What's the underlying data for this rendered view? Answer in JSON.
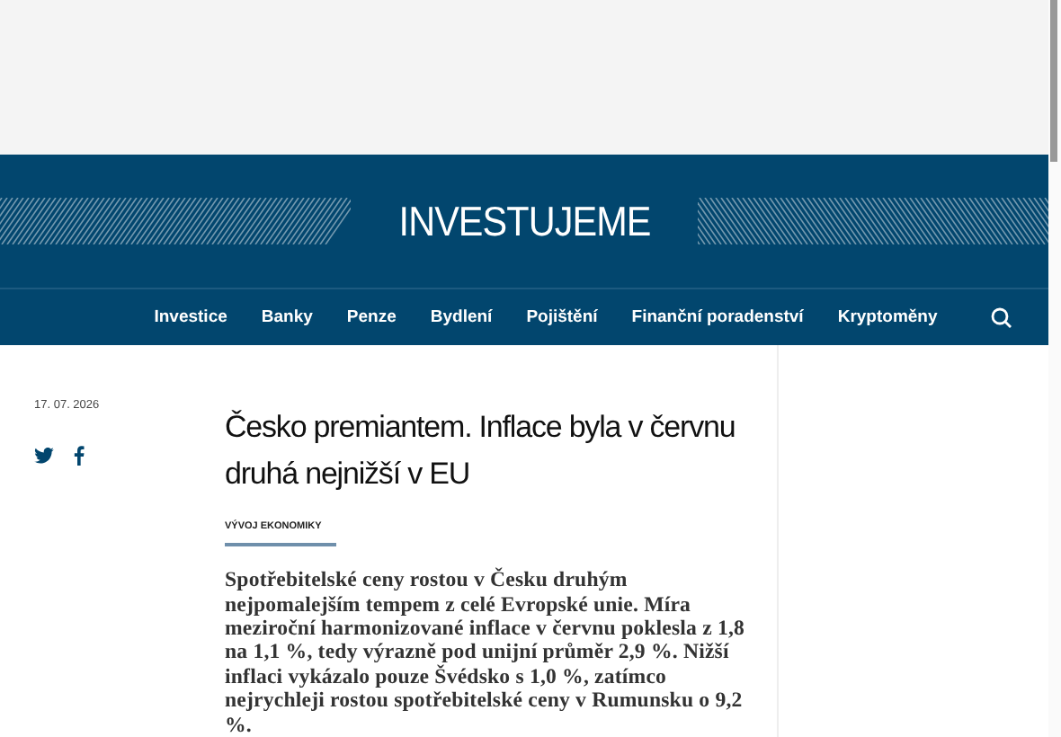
{
  "logo": "INVESTUJEME",
  "nav": [
    {
      "label": "Investice"
    },
    {
      "label": "Banky"
    },
    {
      "label": "Penze"
    },
    {
      "label": "Bydlení"
    },
    {
      "label": "Pojištění"
    },
    {
      "label": "Finanční poradenství"
    },
    {
      "label": "Kryptoměny"
    }
  ],
  "article": {
    "date": "17. 07. 2026",
    "title": "Česko premiantem. Inflace byla v červnu druhá nejnižší v EU",
    "category": "VÝVOJ EKONOMIKY",
    "perex": "Spotřebitelské ceny rostou v Česku druhým nejpomalejším tempem z celé Evropské unie. Míra meziroční harmonizované inflace v červnu poklesla z 1,8 na 1,1 %, tedy výrazně pod unijní průměr 2,9 %. Nižší inflaci vykázalo pouze Švédsko s 1,0 %, zatímco nejrychleji rostou spotřebitelské ceny v Rumunsku o 9,2 %."
  }
}
